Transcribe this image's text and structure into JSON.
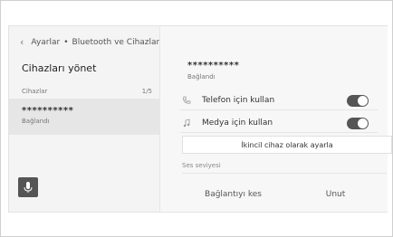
{
  "breadcrumb": {
    "back_icon": "chevron-left-icon",
    "part1": "Ayarlar",
    "separator": "•",
    "part2": "Bluetooth ve Cihazlar"
  },
  "left_panel": {
    "title": "Cihazları yönet",
    "list_header": {
      "label": "Cihazlar",
      "count": "1/5"
    },
    "devices": [
      {
        "name": "**********",
        "status": "Bağlandı"
      }
    ],
    "mic_icon": "microphone-icon"
  },
  "detail": {
    "device_name": "**********",
    "device_status": "Bağlandı",
    "options": [
      {
        "icon": "phone-icon",
        "label": "Telefon için kullan",
        "enabled": true
      },
      {
        "icon": "music-note-icon",
        "label": "Medya için kullan",
        "enabled": true
      }
    ],
    "secondary_button": "İkincil cihaz olarak ayarla",
    "volume_label": "Ses seviyesi",
    "disconnect_button": "Bağlantıyı kes",
    "forget_button": "Unut"
  }
}
